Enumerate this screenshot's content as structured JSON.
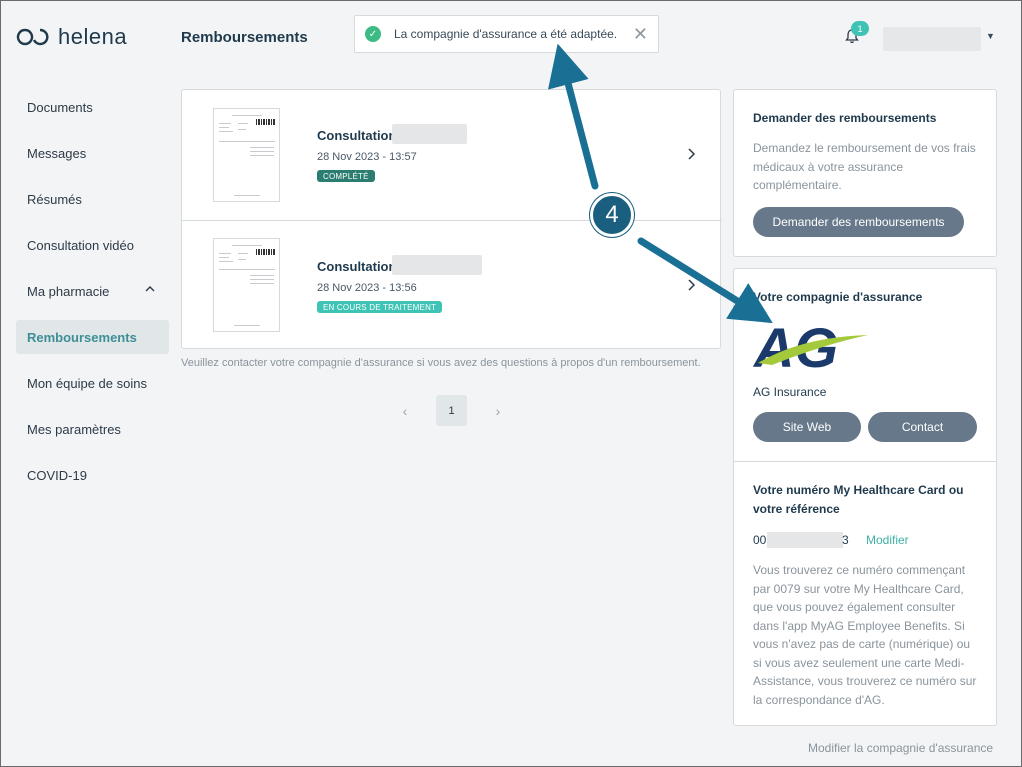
{
  "app": {
    "logo_text": "helena"
  },
  "header": {
    "page_title": "Remboursements",
    "toast_text": "La compagnie d'assurance a été adaptée.",
    "notification_count": "1"
  },
  "sidebar": {
    "items": [
      {
        "label": "Documents"
      },
      {
        "label": "Messages"
      },
      {
        "label": "Résumés"
      },
      {
        "label": "Consultation vidéo"
      },
      {
        "label": "Ma pharmacie"
      },
      {
        "label": "Remboursements"
      },
      {
        "label": "Mon équipe de soins"
      },
      {
        "label": "Mes paramètres"
      },
      {
        "label": "COVID-19"
      }
    ]
  },
  "reimbursements": {
    "rows": [
      {
        "title": "Consultation",
        "date": "28 Nov 2023 - 13:57",
        "status": "COMPLÉTÉ"
      },
      {
        "title": "Consultation",
        "date": "28 Nov 2023 - 13:56",
        "status": "EN COURS DE TRAITEMENT"
      }
    ],
    "note": "Veuillez contacter votre compagnie d'assurance si vous avez des questions à propos d'un remboursement.",
    "pagination": {
      "current": "1"
    }
  },
  "request_panel": {
    "title": "Demander des remboursements",
    "text_lines": [
      "Demandez le remboursement de vos frais",
      "médicaux à votre assurance",
      "complémentaire."
    ],
    "button": "Demander des remboursements"
  },
  "insurer_panel": {
    "title": "Votre compagnie d'assurance",
    "logo_text": "AG",
    "name": "AG Insurance",
    "website_button": "Site Web",
    "contact_button": "Contact",
    "card_title_lines": [
      "Votre numéro My Healthcare Card ou",
      "votre référence"
    ],
    "card_number_start": "00",
    "card_number_end": "3",
    "modify_label": "Modifier",
    "card_info_lines": [
      "Vous trouverez ce numéro commençant",
      "par 0079 sur votre My Healthcare Card,",
      "que vous pouvez également consulter",
      "dans l'app MyAG Employee Benefits. Si",
      "vous n'avez pas de carte (numérique) ou",
      "si vous avez seulement une carte Medi-",
      "Assistance, vous trouverez ce numéro sur",
      "la correspondance d'AG."
    ]
  },
  "footer_link": "Modifier la compagnie d'assurance",
  "annotation": {
    "step_number": "4"
  },
  "colors": {
    "accent": "#3fb1a6",
    "annotation": "#1a6f94",
    "button": "#66788a"
  }
}
